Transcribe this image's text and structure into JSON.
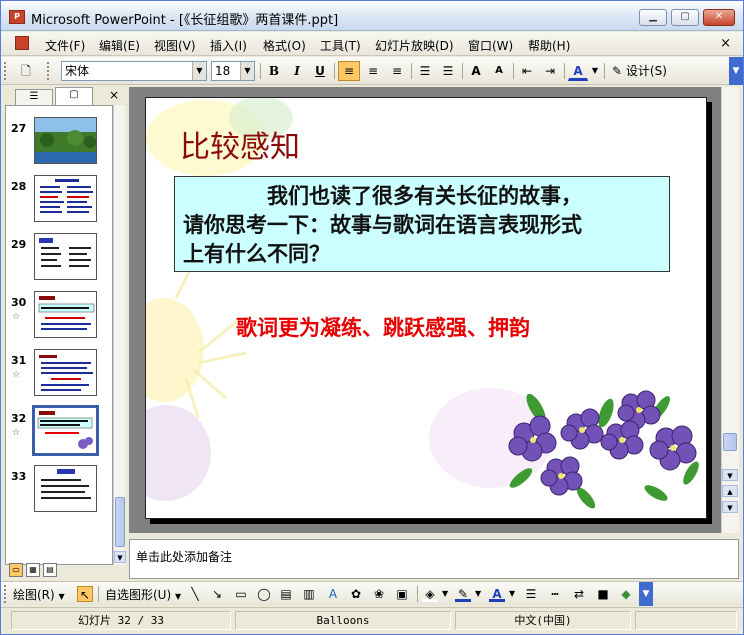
{
  "window": {
    "title": "Microsoft PowerPoint - [《长征组歌》两首课件.ppt]",
    "app_icon_label": "P",
    "minimize_icon": "minimize-icon",
    "maximize_icon": "maximize-icon",
    "close_icon": "close-icon"
  },
  "menubar": {
    "items": [
      "文件(F)",
      "编辑(E)",
      "视图(V)",
      "插入(I)",
      "格式(O)",
      "工具(T)",
      "幻灯片放映(D)",
      "窗口(W)",
      "帮助(H)"
    ],
    "close": "×"
  },
  "toolbar": {
    "font_name": "宋体",
    "font_size": "18",
    "bold": "B",
    "italic": "I",
    "underline": "U",
    "align_left": "≡",
    "align_center": "≡",
    "align_right": "≡",
    "numbering": "☰",
    "bullets": "☰",
    "grow_font": "A",
    "shrink_font": "A",
    "decrease_indent": "⇤",
    "increase_indent": "⇥",
    "font_color": "A",
    "design": "设计(S)",
    "font_color_hex": "#1f3fbf"
  },
  "leftpane": {
    "tab_outline": "☰",
    "tab_slides": "▢",
    "close": "×",
    "thumbnails": [
      {
        "num": "27",
        "star": ""
      },
      {
        "num": "28",
        "star": ""
      },
      {
        "num": "29",
        "star": ""
      },
      {
        "num": "30",
        "star": "☆"
      },
      {
        "num": "31",
        "star": "☆"
      },
      {
        "num": "32",
        "star": "☆"
      },
      {
        "num": "33",
        "star": ""
      }
    ],
    "selected_index": 5
  },
  "slide": {
    "title": "比较感知",
    "body_line1": "我们也读了很多有关长征的故事，",
    "body_line2": "请你思考一下：故事与歌词在语言表现形式",
    "body_line3": "上有什么不同？",
    "answer": "歌词更为凝练、跳跃感强、押韵",
    "title_color": "#8b0a0a",
    "answer_color": "#e60000",
    "textbox_bg": "#ccffff"
  },
  "notes": {
    "placeholder": "单击此处添加备注"
  },
  "drawbar": {
    "draw_menu": "绘图(R)",
    "autoshapes_menu": "自选图形(U)"
  },
  "statusbar": {
    "slide_info": "幻灯片 32 / 33",
    "design_template": "Balloons",
    "language": "中文(中国)"
  }
}
